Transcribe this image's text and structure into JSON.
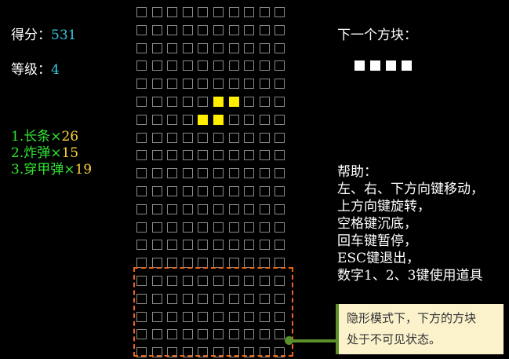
{
  "score": {
    "label": "得分：",
    "value": "531"
  },
  "level": {
    "label": "等级：",
    "value": "4"
  },
  "items": [
    {
      "label": "1.长条×",
      "count": "26"
    },
    {
      "label": "2.炸弹×",
      "count": "15"
    },
    {
      "label": "3.穿甲弹×",
      "count": "19"
    }
  ],
  "next_piece": {
    "label": "下一个方块：",
    "type": "I",
    "color": "#ffffff"
  },
  "board": {
    "rows": 20,
    "cols": 10,
    "active_piece": {
      "type": "S",
      "color": "#ffee00",
      "cells": [
        [
          5,
          5
        ],
        [
          5,
          6
        ],
        [
          6,
          4
        ],
        [
          6,
          5
        ]
      ]
    }
  },
  "help": {
    "title": "帮助：",
    "lines": [
      "左、右、下方向键移动，",
      "上方向键旋转，",
      "空格键沉底，",
      "回车键暂停，",
      "ESC键退出，",
      "数字1、2、3键使用道具"
    ]
  },
  "callout": {
    "lines": [
      "隐形模式下，下方的方块",
      "处于不可见状态。"
    ]
  }
}
